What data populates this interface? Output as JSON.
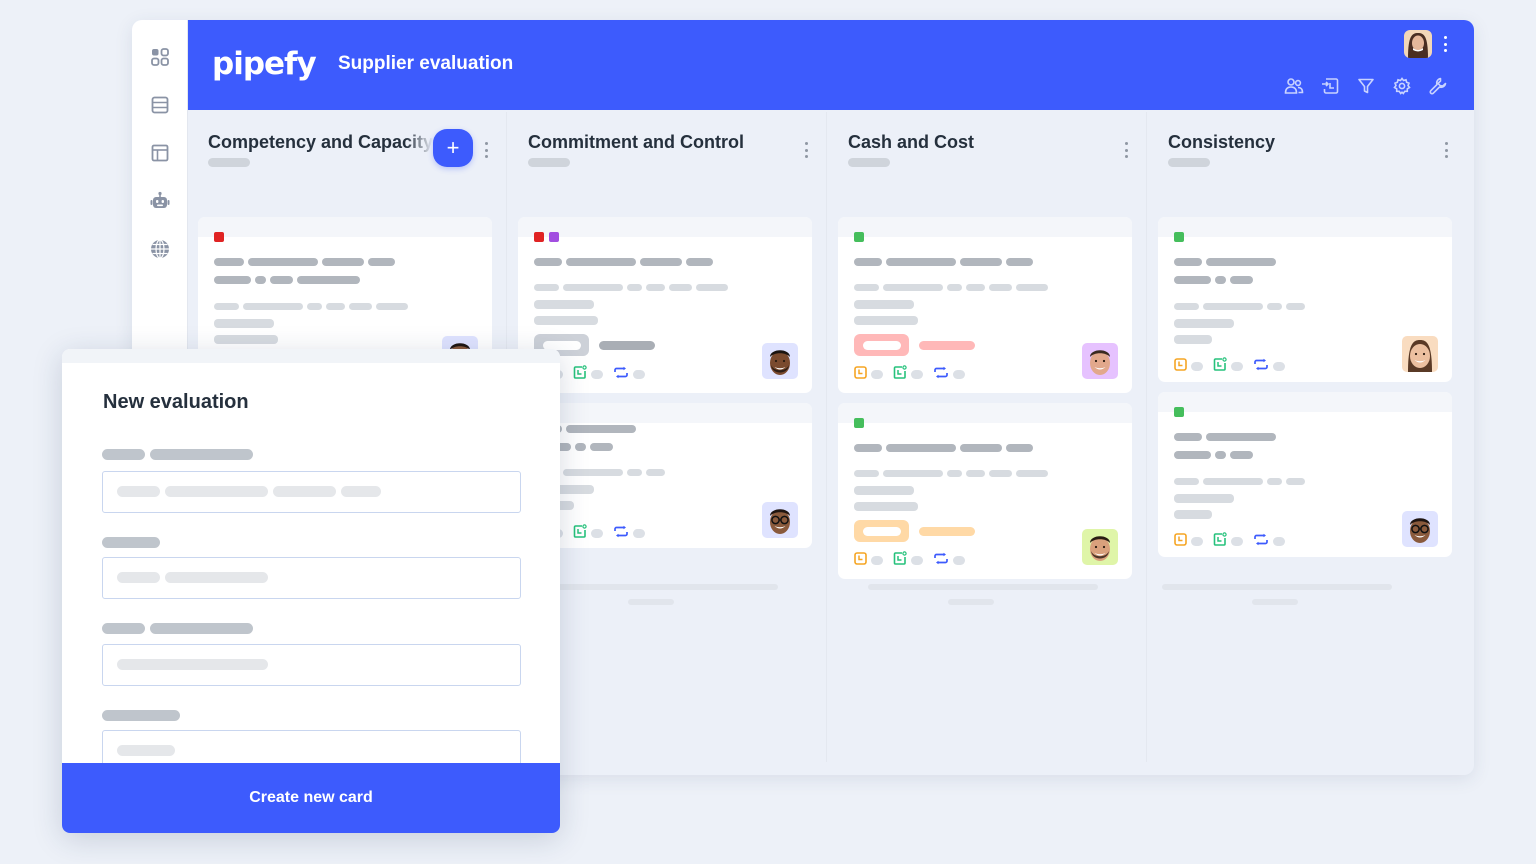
{
  "app": {
    "brand": "pipefy",
    "title": "Supplier evaluation",
    "accent": "#3d5bfd"
  },
  "rail": {
    "items": [
      {
        "icon": "apps-grid-icon"
      },
      {
        "icon": "database-icon"
      },
      {
        "icon": "layout-panel-icon"
      },
      {
        "icon": "robot-icon"
      },
      {
        "icon": "globe-icon"
      }
    ]
  },
  "header": {
    "user_avatar": "user-avatar",
    "tools": [
      "members-icon",
      "import-icon",
      "filter-icon",
      "settings-gear-icon",
      "wrench-icon"
    ]
  },
  "columns": [
    {
      "title": "Competency and Capacity",
      "has_add_button": true,
      "add_label": "+"
    },
    {
      "title": "Commitment and Control"
    },
    {
      "title": "Cash and Cost"
    },
    {
      "title": "Consistency"
    }
  ],
  "tag_colors": {
    "red": "#e02424",
    "purple": "#a24ee0",
    "green": "#45be5c"
  },
  "status_colors": {
    "danger_bg": "#ffb8b8",
    "warning_bg": "#ffd9a6",
    "neutral_bg": "#cdd1d8"
  },
  "modal": {
    "title": "New evaluation",
    "submit_label": "Create new card"
  }
}
